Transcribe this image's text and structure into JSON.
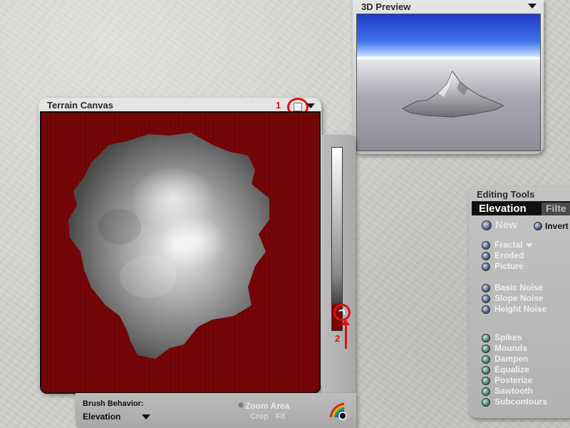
{
  "preview_panel": {
    "title": "3D Preview"
  },
  "canvas_panel": {
    "title": "Terrain Canvas",
    "marker": "1"
  },
  "slider": {
    "marker": "2"
  },
  "brush": {
    "label": "Brush Behavior:",
    "value": "Elevation",
    "zoom_area": "Zoom Area",
    "crop": "Crop",
    "fit": "Fit"
  },
  "tools": {
    "title": "Editing Tools",
    "tabs": [
      "Elevation",
      "Filte"
    ],
    "new_label": "New",
    "invert_label": "Invert",
    "group1": [
      "Fractal",
      "Eroded",
      "Picture"
    ],
    "group2": [
      "Basic Noise",
      "Slope Noise",
      "Height Noise"
    ],
    "group3": [
      "Spikes",
      "Mounds",
      "Dampen",
      "Equalize",
      "Posterize",
      "Sawtooth",
      "Subcontours"
    ]
  },
  "colors": {
    "canvas_red": "#760607",
    "highlight_red": "#e01010",
    "sky_blue": "#2f5fe0"
  },
  "icons": [
    "popup-icon",
    "menu-arrow-icon",
    "zoom-icon",
    "color-picker-icon"
  ]
}
